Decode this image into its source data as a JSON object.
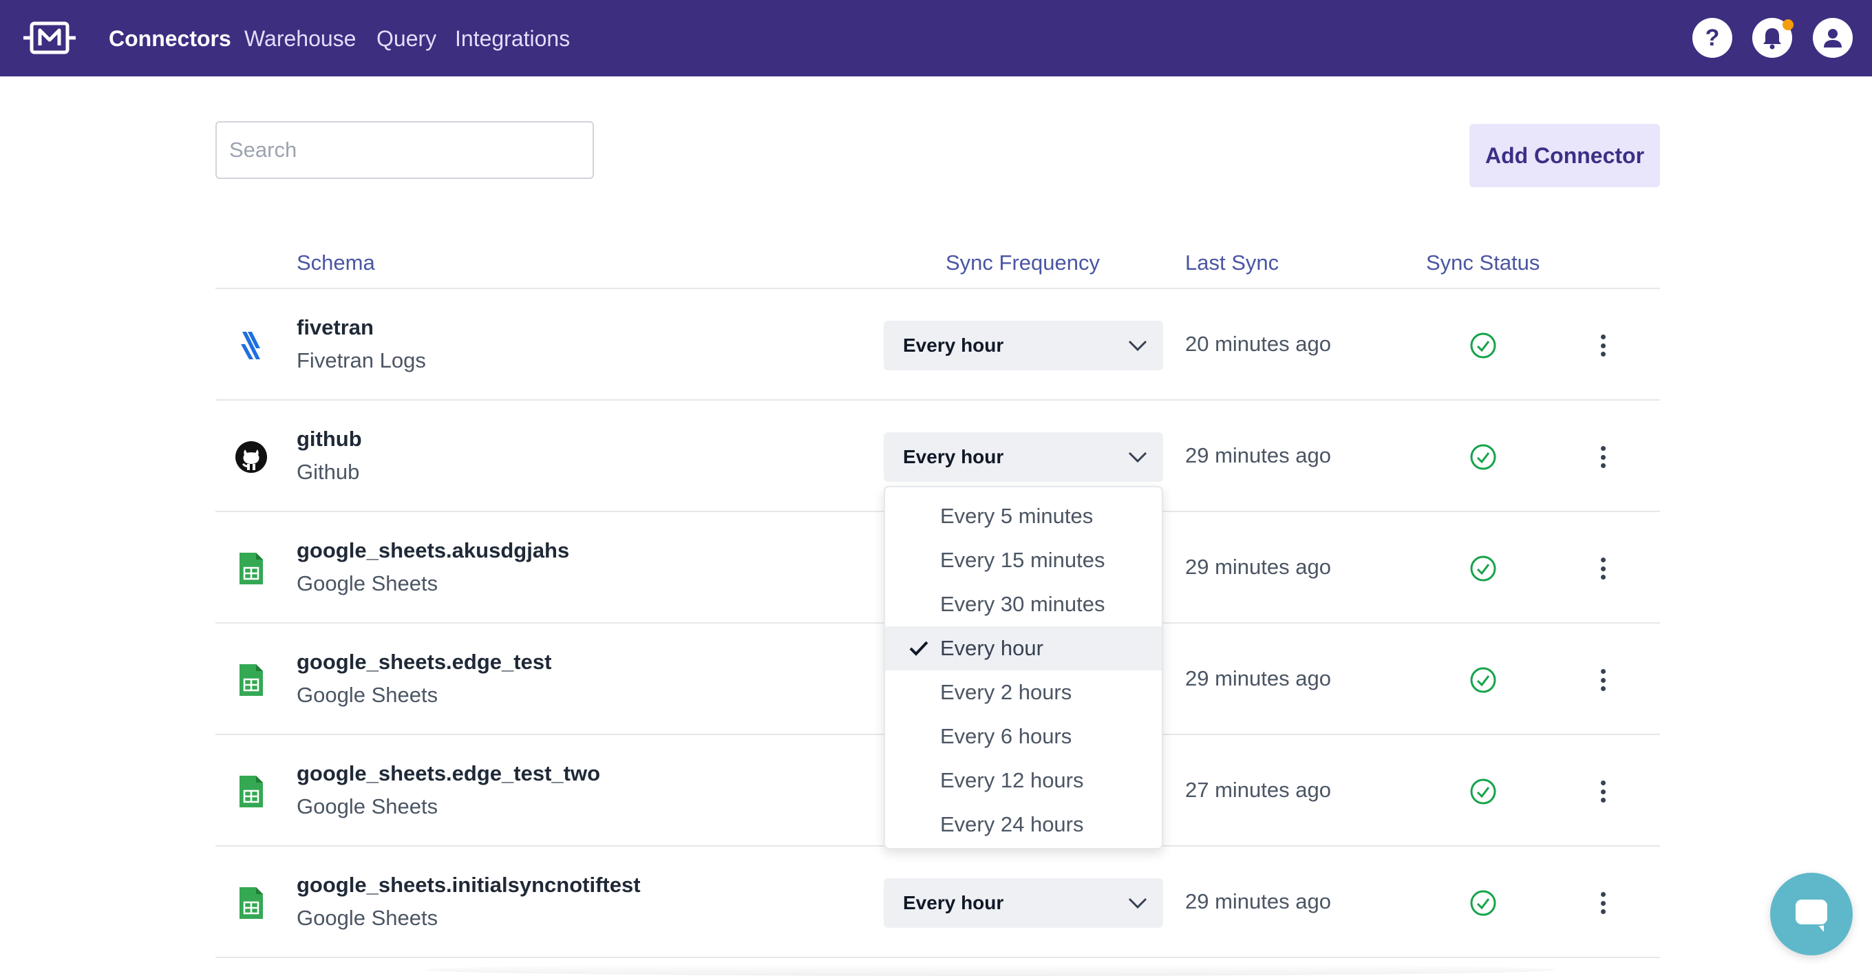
{
  "nav": {
    "links": [
      "Connectors",
      "Warehouse",
      "Query",
      "Integrations"
    ],
    "help_label": "?"
  },
  "search": {
    "placeholder": "Search",
    "value": ""
  },
  "add_button": "Add Connector",
  "table": {
    "headers": {
      "schema": "Schema",
      "sync_frequency": "Sync Frequency",
      "last_sync": "Last Sync",
      "sync_status": "Sync Status"
    },
    "rows": [
      {
        "name": "fivetran",
        "type": "Fivetran Logs",
        "icon": "fivetran-icon",
        "frequency": "Every hour",
        "last_sync": "20 minutes ago",
        "status": "success"
      },
      {
        "name": "github",
        "type": "Github",
        "icon": "github-icon",
        "frequency": "Every hour",
        "last_sync": "29 minutes ago",
        "status": "success"
      },
      {
        "name": "google_sheets.akusdgjahs",
        "type": "Google Sheets",
        "icon": "google-sheets-icon",
        "frequency": "Every hour",
        "last_sync": "29 minutes ago",
        "status": "success"
      },
      {
        "name": "google_sheets.edge_test",
        "type": "Google Sheets",
        "icon": "google-sheets-icon",
        "frequency": "Every hour",
        "last_sync": "29 minutes ago",
        "status": "success"
      },
      {
        "name": "google_sheets.edge_test_two",
        "type": "Google Sheets",
        "icon": "google-sheets-icon",
        "frequency": "Every hour",
        "last_sync": "27 minutes ago",
        "status": "success"
      },
      {
        "name": "google_sheets.initialsyncnotiftest",
        "type": "Google Sheets",
        "icon": "google-sheets-icon",
        "frequency": "Every hour",
        "last_sync": "29 minutes ago",
        "status": "success"
      }
    ]
  },
  "frequency_dropdown": {
    "open_for_row": "github",
    "options": [
      "Every 5 minutes",
      "Every 15 minutes",
      "Every 30 minutes",
      "Every hour",
      "Every 2 hours",
      "Every 6 hours",
      "Every 12 hours",
      "Every 24 hours"
    ],
    "selected": "Every hour"
  },
  "colors": {
    "nav_bg": "#3d2e80",
    "header_text": "#4a55a2",
    "success": "#16a34a",
    "sheets_green": "#34a853",
    "fivetran_blue": "#1e6fe0",
    "chat": "#5fb8c9",
    "notification_dot": "#f59e0b"
  }
}
